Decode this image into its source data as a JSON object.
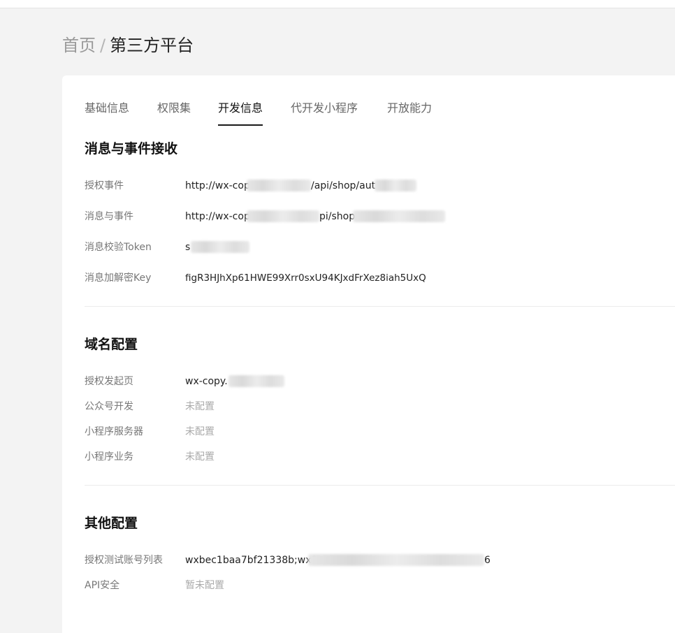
{
  "breadcrumb": {
    "home": "首页",
    "separator": "/",
    "current": "第三方平台"
  },
  "tabs": [
    {
      "label": "基础信息",
      "active": false
    },
    {
      "label": "权限集",
      "active": false
    },
    {
      "label": "开发信息",
      "active": true
    },
    {
      "label": "代开发小程序",
      "active": false
    },
    {
      "label": "开放能力",
      "active": false
    }
  ],
  "sections": {
    "message": {
      "title": "消息与事件接收",
      "rows": [
        {
          "label": "授权事件",
          "value_start": "http://wx-cop",
          "value_end": "/api/shop/aut"
        },
        {
          "label": "消息与事件",
          "value_start": "http://wx-cop",
          "value_end": "pi/shop"
        },
        {
          "label": "消息校验Token",
          "value_start": "s",
          "value_end": ""
        },
        {
          "label": "消息加解密Key",
          "value_start": "figR3HJhXp61HWE99Xrr0sxU94KJxdFrXez8iah5UxQ",
          "value_end": ""
        }
      ]
    },
    "domain": {
      "title": "域名配置",
      "rows": [
        {
          "label": "授权发起页",
          "value": "wx-copy."
        },
        {
          "label": "公众号开发",
          "value": "未配置"
        },
        {
          "label": "小程序服务器",
          "value": "未配置"
        },
        {
          "label": "小程序业务",
          "value": "未配置"
        }
      ]
    },
    "other": {
      "title": "其他配置",
      "rows": [
        {
          "label": "授权测试账号列表",
          "value_start": "wxbec1baa7bf21338b;wx9",
          "value_end": "6"
        },
        {
          "label": "API安全",
          "value": "暂未配置"
        }
      ]
    }
  },
  "colors": {
    "page_bg": "#f3f3f3",
    "card_bg": "#ffffff",
    "active_tab_underline": "#1a1a1a",
    "muted_text": "#aaaaaa"
  }
}
